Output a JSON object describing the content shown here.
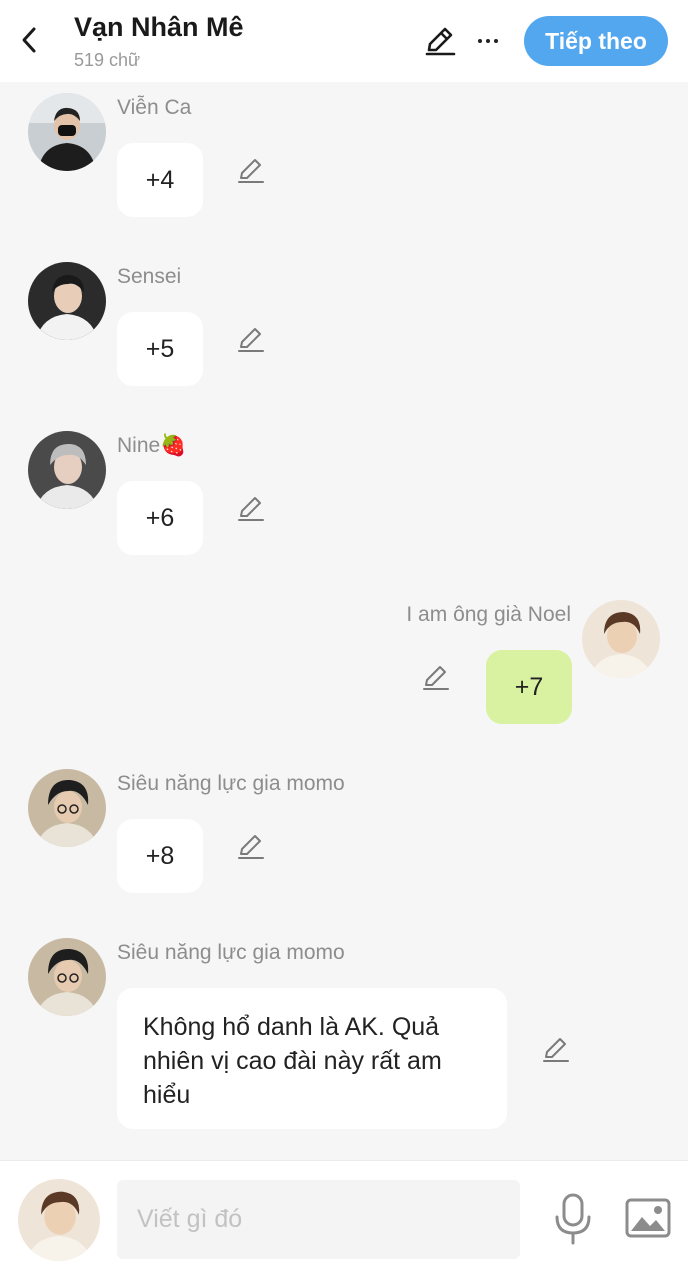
{
  "header": {
    "title": "Vạn Nhân Mê",
    "subtitle": "519 chữ",
    "next_label": "Tiếp theo"
  },
  "messages": [
    {
      "sender": "Viễn Ca",
      "text": "+4",
      "side": "left"
    },
    {
      "sender": "Sensei",
      "text": "+5",
      "side": "left"
    },
    {
      "sender": "Nine🍓",
      "text": "+6",
      "side": "left"
    },
    {
      "sender": "I am ông già Noel",
      "text": "+7",
      "side": "right"
    },
    {
      "sender": "Siêu năng lực gia momo",
      "text": "+8",
      "side": "left"
    },
    {
      "sender": "Siêu năng lực gia momo",
      "text": "Không hổ danh là AK. Quả nhiên vị cao đài này rất am hiểu",
      "side": "left"
    }
  ],
  "composer": {
    "placeholder": "Viết gì đó"
  },
  "icons": {
    "back": "chevron-left-icon",
    "edit": "pencil-icon",
    "more": "more-dots-icon",
    "mic": "microphone-icon",
    "image": "image-icon"
  },
  "colors": {
    "accent": "#53a7ef",
    "own_bubble": "#d8f2a1",
    "bubble": "#ffffff",
    "background": "#f6f6f6"
  }
}
